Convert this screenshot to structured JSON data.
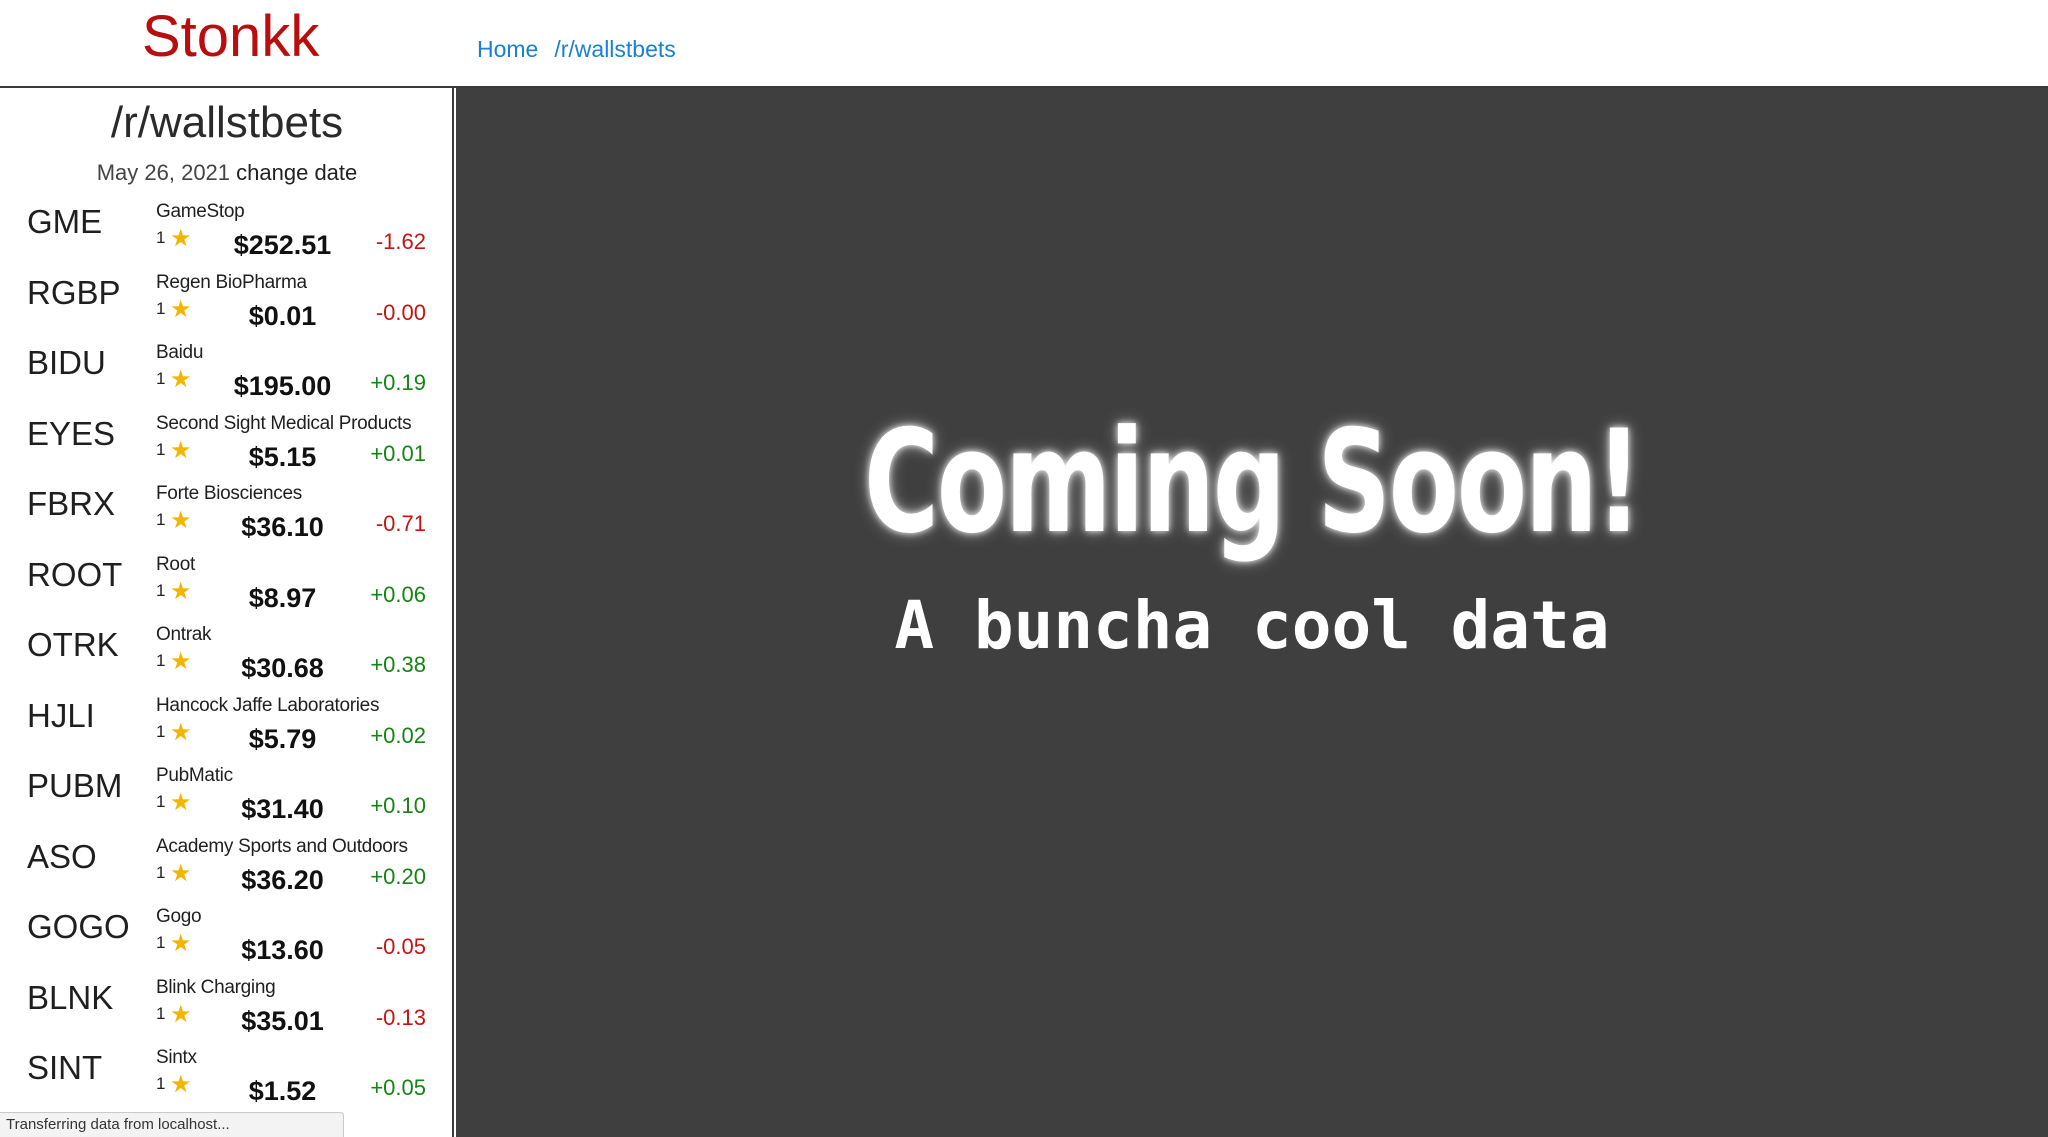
{
  "app": {
    "brand": "Stonkk",
    "nav": [
      {
        "label": "Home"
      },
      {
        "label": "/r/wallstbets"
      }
    ]
  },
  "sidebar": {
    "title": "/r/wallstbets",
    "date": "May 26, 2021",
    "change_date_label": "change date",
    "stocks": [
      {
        "ticker": "GME",
        "name": "GameStop",
        "rank": "1",
        "price": "$252.51",
        "change": "-1.62",
        "direction": "down"
      },
      {
        "ticker": "RGBP",
        "name": "Regen BioPharma",
        "rank": "1",
        "price": "$0.01",
        "change": "-0.00",
        "direction": "down"
      },
      {
        "ticker": "BIDU",
        "name": "Baidu",
        "rank": "1",
        "price": "$195.00",
        "change": "+0.19",
        "direction": "up"
      },
      {
        "ticker": "EYES",
        "name": "Second Sight Medical Products",
        "rank": "1",
        "price": "$5.15",
        "change": "+0.01",
        "direction": "up"
      },
      {
        "ticker": "FBRX",
        "name": "Forte Biosciences",
        "rank": "1",
        "price": "$36.10",
        "change": "-0.71",
        "direction": "down"
      },
      {
        "ticker": "ROOT",
        "name": "Root",
        "rank": "1",
        "price": "$8.97",
        "change": "+0.06",
        "direction": "up"
      },
      {
        "ticker": "OTRK",
        "name": "Ontrak",
        "rank": "1",
        "price": "$30.68",
        "change": "+0.38",
        "direction": "up"
      },
      {
        "ticker": "HJLI",
        "name": "Hancock Jaffe Laboratories",
        "rank": "1",
        "price": "$5.79",
        "change": "+0.02",
        "direction": "up"
      },
      {
        "ticker": "PUBM",
        "name": "PubMatic",
        "rank": "1",
        "price": "$31.40",
        "change": "+0.10",
        "direction": "up"
      },
      {
        "ticker": "ASO",
        "name": "Academy Sports and Outdoors",
        "rank": "1",
        "price": "$36.20",
        "change": "+0.20",
        "direction": "up"
      },
      {
        "ticker": "GOGO",
        "name": "Gogo",
        "rank": "1",
        "price": "$13.60",
        "change": "-0.05",
        "direction": "down"
      },
      {
        "ticker": "BLNK",
        "name": "Blink Charging",
        "rank": "1",
        "price": "$35.01",
        "change": "-0.13",
        "direction": "down"
      },
      {
        "ticker": "SINT",
        "name": "Sintx",
        "rank": "1",
        "price": "$1.52",
        "change": "+0.05",
        "direction": "up"
      }
    ]
  },
  "main": {
    "headline": "Coming Soon!",
    "subheadline": "A buncha cool data"
  },
  "status_bar": {
    "text": "Transferring data from localhost..."
  },
  "colors": {
    "brand": "#b80e0e",
    "link": "#1a7fd9",
    "negative": "#c41414",
    "positive": "#148414",
    "star": "#f2b600",
    "main_background": "#3f3f3f"
  }
}
